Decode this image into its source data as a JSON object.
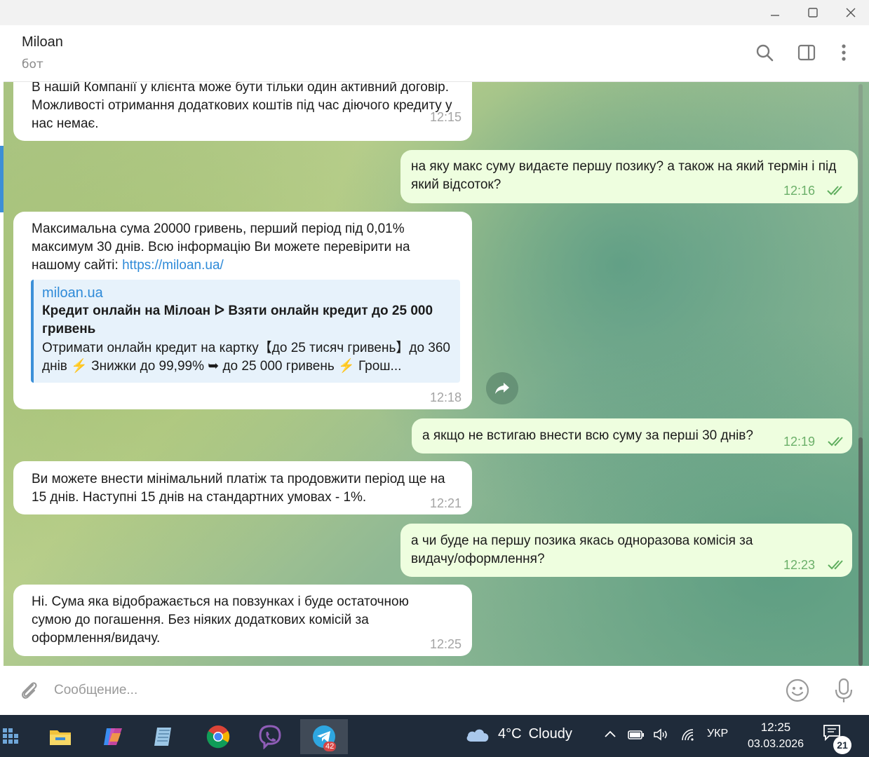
{
  "window": {
    "minimize_icon": "minimize-icon",
    "maximize_icon": "maximize-icon",
    "close_icon": "close-icon"
  },
  "header": {
    "title": "Miloan",
    "subtitle": "бот",
    "icons": [
      "search-icon",
      "sidebar-toggle-icon",
      "more-vertical-icon"
    ]
  },
  "messages": [
    {
      "dir": "in",
      "text": "В нашій Компанії у клієнта може бути тільки один активний договір. Можливості отримання додаткових коштів під час діючого кредиту у нас немає.",
      "time": "12:15"
    },
    {
      "dir": "out",
      "text": "на яку макс суму видаєте першу позику? а також на який термін і під який відсоток?",
      "time": "12:16"
    },
    {
      "dir": "in",
      "text_before_link": "Максимальна сума 20000 гривень, перший період під 0,01% максимум 30 днів. Всю інформацію Ви можете перевірити на нашому сайті: ",
      "link": "https://miloan.ua/",
      "preview": {
        "site": "miloan.ua",
        "title": "Кредит онлайн на Мілоан ᐅ Взяти онлайн кредит до 25 000 гривень",
        "description": "Отримати онлайн кредит на картку【до 25 тисяч гривень】до 360 днів ⚡ Знижки до 99,99% ➥ до 25 000 гривень ⚡ Грош..."
      },
      "time": "12:18"
    },
    {
      "dir": "out",
      "text": "а якщо не встигаю внести всю суму за перші 30 днів?",
      "time": "12:19"
    },
    {
      "dir": "in",
      "text": "Ви можете внести мінімальний платіж та продовжити період ще на 15 днів. Наступні 15 днів на стандартних умовах - 1%.",
      "time": "12:21"
    },
    {
      "dir": "out",
      "text": "а чи буде на першу позика якась одноразова комісія за видачу/оформлення?",
      "time": "12:23"
    },
    {
      "dir": "in",
      "text": "Ні. Сума яка відображається на повзунках і буде остаточною сумою до погашення. Без ніяких додаткових комісій за оформлення/видачу.",
      "time": "12:25"
    }
  ],
  "composer": {
    "placeholder": "Сообщение...",
    "attach_icon": "paperclip-icon",
    "emoji_icon": "emoji-icon",
    "mic_icon": "microphone-icon"
  },
  "taskbar": {
    "apps": [
      "start-icon",
      "file-explorer-icon",
      "copilot-icon",
      "notepad-icon",
      "chrome-icon",
      "viber-icon",
      "telegram-icon"
    ],
    "telegram_badge": "42",
    "weather": {
      "temp": "4°C",
      "condition": "Cloudy"
    },
    "language": "УКР",
    "time": "12:25",
    "date": "03.03.2026",
    "notifications": "21"
  },
  "colors": {
    "incoming_bubble": "#ffffff",
    "outgoing_bubble": "#eefedf",
    "link": "#2e8ad8",
    "read_ticks": "#5fae5e",
    "taskbar": "#1f2b3a"
  }
}
